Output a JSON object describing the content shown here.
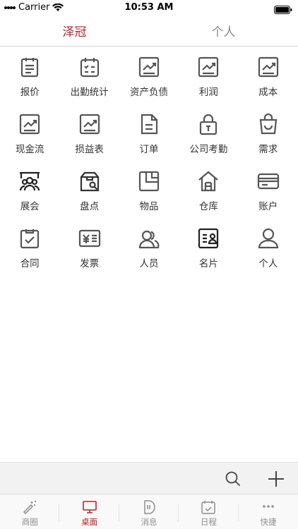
{
  "status_bar": {
    "carrier": "Carrier",
    "time": "10:53 AM"
  },
  "top_tabs": [
    {
      "label": "泽冠",
      "active": true
    },
    {
      "label": "个人",
      "active": false
    }
  ],
  "grid": [
    [
      {
        "label": "报价",
        "icon": "clipboard-list-icon"
      },
      {
        "label": "出勤统计",
        "icon": "calendar-check-icon"
      },
      {
        "label": "资产负债",
        "icon": "trend-chart-icon"
      },
      {
        "label": "利润",
        "icon": "trend-chart-icon"
      },
      {
        "label": "成本",
        "icon": "trend-chart-icon"
      }
    ],
    [
      {
        "label": "现金流",
        "icon": "trend-chart-icon"
      },
      {
        "label": "损益表",
        "icon": "trend-chart-icon"
      },
      {
        "label": "订单",
        "icon": "document-icon"
      },
      {
        "label": "公司考勤",
        "icon": "lock-icon"
      },
      {
        "label": "需求",
        "icon": "shopping-bag-icon"
      }
    ],
    [
      {
        "label": "展会",
        "icon": "exhibition-icon"
      },
      {
        "label": "盘点",
        "icon": "inventory-search-icon"
      },
      {
        "label": "物品",
        "icon": "goods-icon"
      },
      {
        "label": "仓库",
        "icon": "warehouse-icon"
      },
      {
        "label": "账户",
        "icon": "card-icon"
      }
    ],
    [
      {
        "label": "合同",
        "icon": "contract-check-icon"
      },
      {
        "label": "发票",
        "icon": "invoice-icon"
      },
      {
        "label": "人员",
        "icon": "people-icon"
      },
      {
        "label": "名片",
        "icon": "business-card-icon"
      },
      {
        "label": "个人",
        "icon": "person-icon"
      }
    ]
  ],
  "tab_bar": [
    {
      "label": "商圈",
      "icon": "magic-wand-icon",
      "active": false
    },
    {
      "label": "桌面",
      "icon": "desktop-icon",
      "active": true
    },
    {
      "label": "消息",
      "icon": "message-icon",
      "active": false
    },
    {
      "label": "日程",
      "icon": "calendar-icon",
      "active": false
    },
    {
      "label": "快捷",
      "icon": "more-dots-icon",
      "active": false
    }
  ],
  "colors": {
    "accent": "#b8222b",
    "icon_gray": "#555555"
  }
}
